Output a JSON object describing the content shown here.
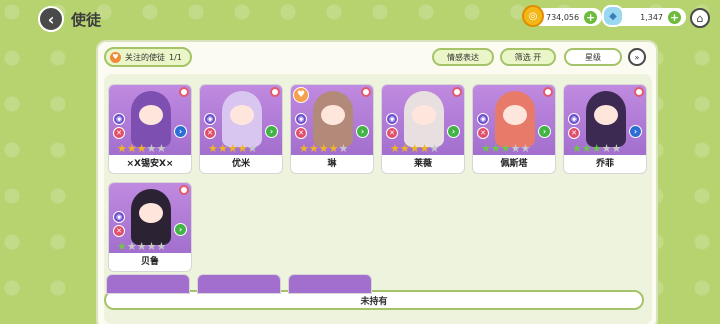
{
  "header": {
    "back_icon": "back-arrow-icon",
    "title": "使徒",
    "gold": "734,056",
    "gems": "1,347",
    "home_icon": "home-icon"
  },
  "filters": {
    "favorites_label": "关注的使徒",
    "favorites_count": "1/1",
    "emotion_label": "情感表达",
    "filter_label": "筛选 开",
    "star_label": "星级",
    "dropdown_icon": "double-chevron-down-icon"
  },
  "apostles": [
    {
      "name": "×X锡安X×",
      "stars_filled": 3,
      "star_color": "#f0b620",
      "art_color": "#7d4fb0"
    },
    {
      "name": "优米",
      "stars_filled": 4,
      "star_color": "#f0b620",
      "art_color": "#d8c6f0"
    },
    {
      "name": "琳",
      "stars_filled": 4,
      "star_color": "#f0b620",
      "art_color": "#b38a7a",
      "favorite": true
    },
    {
      "name": "莱薇",
      "stars_filled": 4,
      "star_color": "#f0b620",
      "art_color": "#e8e0e0"
    },
    {
      "name": "佩斯塔",
      "stars_filled": 3,
      "star_color": "#6cc74a",
      "art_color": "#e87a6a"
    },
    {
      "name": "乔菲",
      "stars_filled": 3,
      "star_color": "#6cc74a",
      "art_color": "#3d2a52"
    },
    {
      "name": "贝鲁",
      "stars_filled": 1,
      "star_color": "#6cc74a",
      "art_color": "#2b2233"
    }
  ],
  "unowned_label": "未持有",
  "colors": {
    "background": "#b6d36f",
    "card_art": "#a36fce",
    "accent_green": "#6cc74a",
    "star_gold": "#f0b620"
  }
}
